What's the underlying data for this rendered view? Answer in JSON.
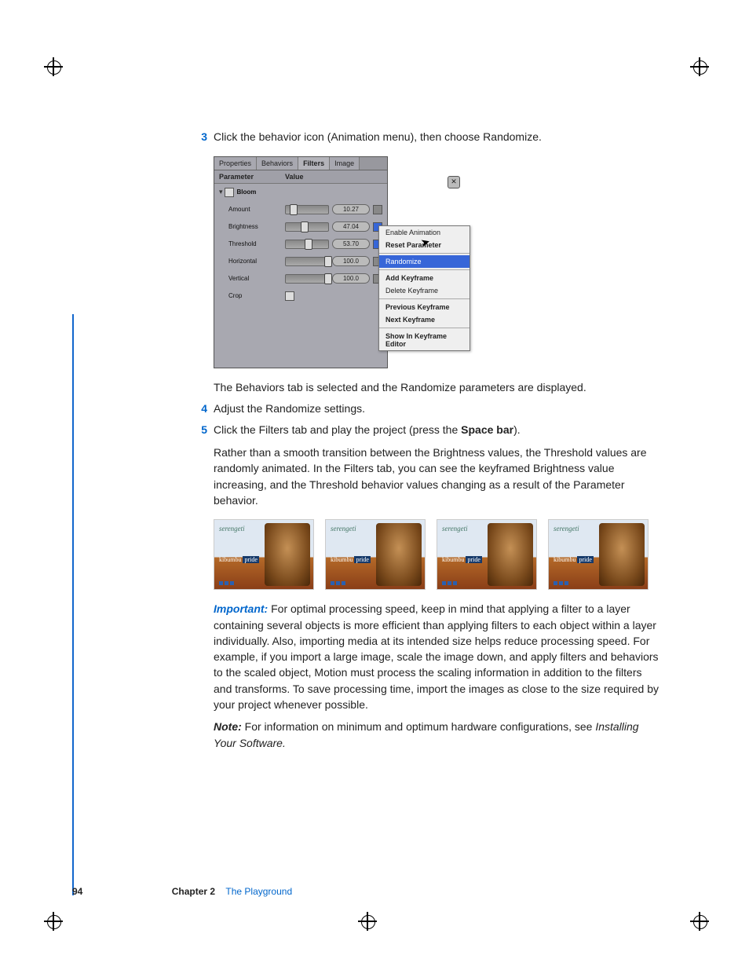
{
  "steps": {
    "s3": {
      "num": "3",
      "text": "Click the behavior icon (Animation menu), then choose Randomize."
    },
    "s3_follow": "The Behaviors tab is selected and the Randomize parameters are displayed.",
    "s4": {
      "num": "4",
      "text": "Adjust the Randomize settings."
    },
    "s5": {
      "num": "5",
      "pre": "Click the Filters tab and play the project (press the ",
      "bold": "Space bar",
      "post": ")."
    },
    "s5_follow": "Rather than a smooth transition between the Brightness values, the Threshold values are randomly animated. In the Filters tab, you can see the keyframed Brightness value increasing, and the Threshold behavior values changing as a result of the Parameter behavior."
  },
  "important": {
    "label": "Important:  ",
    "text": "For optimal processing speed, keep in mind that applying a filter to a layer containing several objects is more efficient than applying filters to each object within a layer individually. Also, importing media at its intended size helps reduce processing speed. For example, if you import a large image, scale the image down, and apply filters and behaviors to the scaled object, Motion must process the scaling information in addition to the filters and transforms. To save processing time, import the images as close to the size required by your project whenever possible."
  },
  "note": {
    "label": "Note:  ",
    "text": "For information on minimum and optimum hardware configurations, see ",
    "italic": "Installing Your Software."
  },
  "panel": {
    "tabs": [
      "Properties",
      "Behaviors",
      "Filters",
      "Image"
    ],
    "activeTab": 2,
    "head": {
      "param": "Parameter",
      "value": "Value"
    },
    "group": "Bloom",
    "rows": [
      {
        "name": "Amount",
        "value": "10.27"
      },
      {
        "name": "Brightness",
        "value": "47.04"
      },
      {
        "name": "Threshold",
        "value": "53.70"
      },
      {
        "name": "Horizontal",
        "value": "100.0"
      },
      {
        "name": "Vertical",
        "value": "100.0"
      }
    ],
    "crop": "Crop"
  },
  "menu": {
    "items": [
      "Enable Animation",
      "Reset Parameter",
      "Randomize",
      "Add Keyframe",
      "Delete Keyframe",
      "Previous Keyframe",
      "Next Keyframe",
      "Show In Keyframe Editor"
    ]
  },
  "thumbs": {
    "title": "serengeti",
    "sub1": "kibumbu",
    "sub2": "pride"
  },
  "footer": {
    "page": "94",
    "chapter": "Chapter 2",
    "name": "The Playground"
  }
}
